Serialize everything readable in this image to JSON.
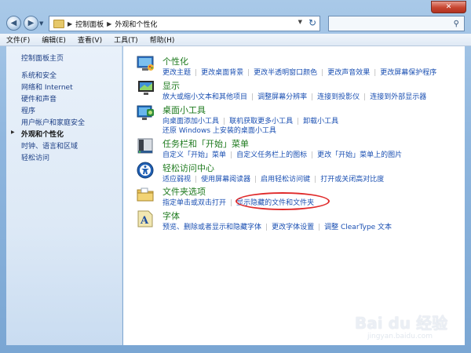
{
  "address_bar": {
    "crumbs": [
      "控制面板",
      "外观和个性化"
    ],
    "separator": "▶"
  },
  "search": {
    "placeholder": ""
  },
  "window_controls": {
    "close_glyph": "✕"
  },
  "menu": [
    "文件(F)",
    "编辑(E)",
    "查看(V)",
    "工具(T)",
    "帮助(H)"
  ],
  "sidebar": {
    "home": "控制面板主页",
    "items": [
      {
        "label": "系统和安全"
      },
      {
        "label": "网络和 Internet"
      },
      {
        "label": "硬件和声音"
      },
      {
        "label": "程序"
      },
      {
        "label": "用户帐户和家庭安全"
      },
      {
        "label": "外观和个性化",
        "active": true
      },
      {
        "label": "时钟、语言和区域"
      },
      {
        "label": "轻松访问"
      }
    ]
  },
  "categories": [
    {
      "title": "个性化",
      "icon": "personalization-icon",
      "lines": [
        [
          "更改主题",
          "更改桌面背景",
          "更改半透明窗口颜色",
          "更改声音效果",
          "更改屏幕保护程序"
        ]
      ]
    },
    {
      "title": "显示",
      "icon": "display-icon",
      "lines": [
        [
          "放大或缩小文本和其他项目",
          "调整屏幕分辨率",
          "连接到投影仪",
          "连接到外部显示器"
        ]
      ]
    },
    {
      "title": "桌面小工具",
      "icon": "gadgets-icon",
      "lines": [
        [
          "向桌面添加小工具",
          "联机获取更多小工具",
          "卸载小工具"
        ],
        [
          "还原 Windows 上安装的桌面小工具"
        ]
      ]
    },
    {
      "title": "任务栏和「开始」菜单",
      "icon": "taskbar-icon",
      "lines": [
        [
          "自定义「开始」菜单",
          "自定义任务栏上的图标",
          "更改「开始」菜单上的图片"
        ]
      ]
    },
    {
      "title": "轻松访问中心",
      "icon": "ease-of-access-icon",
      "lines": [
        [
          "适应弱视",
          "使用屏幕阅读器",
          "启用轻松访问键",
          "打开或关闭高对比度"
        ]
      ]
    },
    {
      "title": "文件夹选项",
      "icon": "folder-options-icon",
      "lines": [
        [
          "指定单击或双击打开",
          "显示隐藏的文件和文件夹"
        ]
      ]
    },
    {
      "title": "字体",
      "icon": "fonts-icon",
      "lines": [
        [
          "预览、删除或者显示和隐藏字体",
          "更改字体设置",
          "调整 ClearType 文本"
        ]
      ]
    }
  ],
  "watermark": {
    "logo_text": "Bai du 经验",
    "url": "jingyan.baidu.com"
  }
}
